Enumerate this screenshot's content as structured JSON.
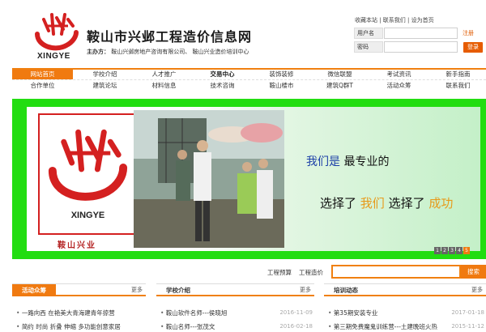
{
  "header": {
    "logo_text": "XINGYE",
    "site_title": "鞍山市兴邺工程造价信息网",
    "sponsor_label": "主办方：",
    "sponsor_orgs": "鞍山兴邺房地产咨询有限公司、 鞍山兴业造价培训中心",
    "top_links": "收藏本站 | 联系我们 | 设为首页",
    "username_label": "用户名",
    "password_label": "密码",
    "register_label": "注册",
    "login_label": "登录"
  },
  "nav": {
    "row1": [
      "网站首页",
      "学校介绍",
      "人才推广",
      "交易中心",
      "装饰装修",
      "微信联盟",
      "考试资讯",
      "新手指南"
    ],
    "row2": [
      "合作单位",
      "建筑论坛",
      "材料信息",
      "技术咨询",
      "鞍山楼市",
      "建筑Q群T",
      "活动众筹",
      "联系我们"
    ]
  },
  "banner": {
    "logo_text": "XINGYE",
    "org_name": "鞍山兴业",
    "line1_a": "我们是",
    "line1_b": "最专业的",
    "line2_a": "选择了",
    "line2_b": "我们",
    "line2_c": "选择了",
    "line2_d": "成功",
    "pages": [
      "1",
      "2",
      "3",
      "4",
      "5"
    ],
    "active_page": "5"
  },
  "search": {
    "link1": "工程预算",
    "link2": "工程造价",
    "button": "搜索",
    "placeholder": ""
  },
  "panels": [
    {
      "title": "活动众筹",
      "more": "更多",
      "items": [
        {
          "text": "一路向西 在艳美大青海建青年掠营",
          "date": ""
        },
        {
          "text": "简约 时尚 折叠 伸缩 多功能创意家居",
          "date": ""
        }
      ]
    },
    {
      "title": "学校介绍",
      "more": "更多",
      "items": [
        {
          "text": "鞍山软件名师---侯晓旭",
          "date": "2016-11-09"
        },
        {
          "text": "鞍山名师---张茂文",
          "date": "2016-02-18"
        }
      ]
    },
    {
      "title": "培训动态",
      "more": "更多",
      "items": [
        {
          "text": "第35期安装专业",
          "date": "2017-01-18"
        },
        {
          "text": "第三期免费魔鬼训练营---土建晚班火热",
          "date": "2015-11-12"
        }
      ]
    }
  ],
  "colors": {
    "accent": "#f07a10",
    "banner_green": "#22dd11",
    "brand_red": "#d42020"
  }
}
